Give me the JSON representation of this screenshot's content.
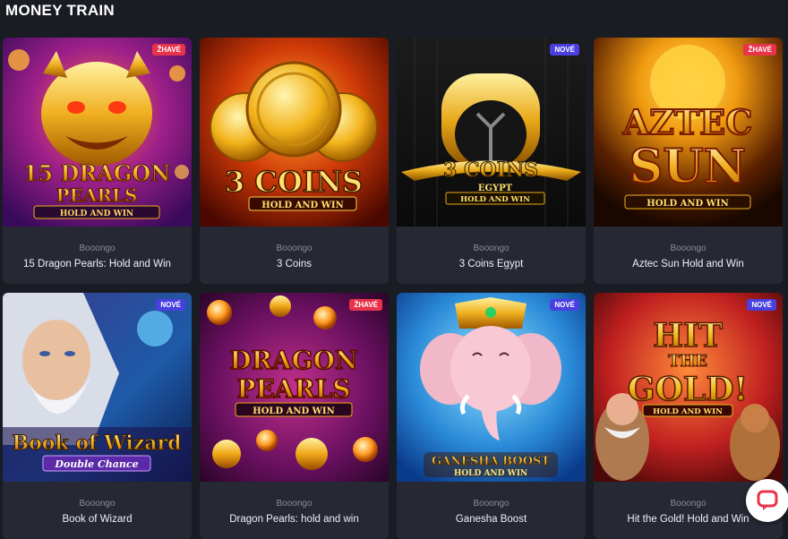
{
  "section": {
    "title": "MONEY TRAIN"
  },
  "colors": {
    "badge_hot": "#e8334a",
    "badge_new": "#4a3fe0",
    "background": "#1a1c24",
    "card": "#262833"
  },
  "games": [
    {
      "provider": "Booongo",
      "name": "15 Dragon Pearls: Hold and Win",
      "badge": "ŽHAVÉ",
      "badge_type": "hot",
      "art_lines": [
        "15 DRAGON",
        "PEARLS",
        "HOLD AND WIN"
      ]
    },
    {
      "provider": "Booongo",
      "name": "3 Coins",
      "badge": "",
      "badge_type": "",
      "art_lines": [
        "3 COINS",
        "HOLD AND WIN"
      ]
    },
    {
      "provider": "Booongo",
      "name": "3 Coins Egypt",
      "badge": "NOVÉ",
      "badge_type": "new",
      "art_lines": [
        "3 COINS",
        "EGYPT",
        "HOLD AND WIN"
      ]
    },
    {
      "provider": "Booongo",
      "name": "Aztec Sun Hold and Win",
      "badge": "ŽHAVÉ",
      "badge_type": "hot",
      "art_lines": [
        "AZTEC",
        "SUN",
        "HOLD AND WIN"
      ]
    },
    {
      "provider": "Booongo",
      "name": "Book of Wizard",
      "badge": "NOVÉ",
      "badge_type": "new",
      "art_lines": [
        "Book of Wizard",
        "Double Chance"
      ]
    },
    {
      "provider": "Booongo",
      "name": "Dragon Pearls: hold and win",
      "badge": "ŽHAVÉ",
      "badge_type": "hot",
      "art_lines": [
        "DRAGON",
        "PEARLS",
        "HOLD AND WIN"
      ]
    },
    {
      "provider": "Booongo",
      "name": "Ganesha Boost",
      "badge": "NOVÉ",
      "badge_type": "new",
      "art_lines": [
        "GANESHA BOOST",
        "HOLD AND WIN"
      ]
    },
    {
      "provider": "Booongo",
      "name": "Hit the Gold! Hold and Win",
      "badge": "NOVÉ",
      "badge_type": "new",
      "art_lines": [
        "HIT",
        "THE",
        "GOLD!",
        "HOLD AND WIN"
      ]
    }
  ],
  "chat": {
    "icon": "chat-bubble-icon"
  }
}
